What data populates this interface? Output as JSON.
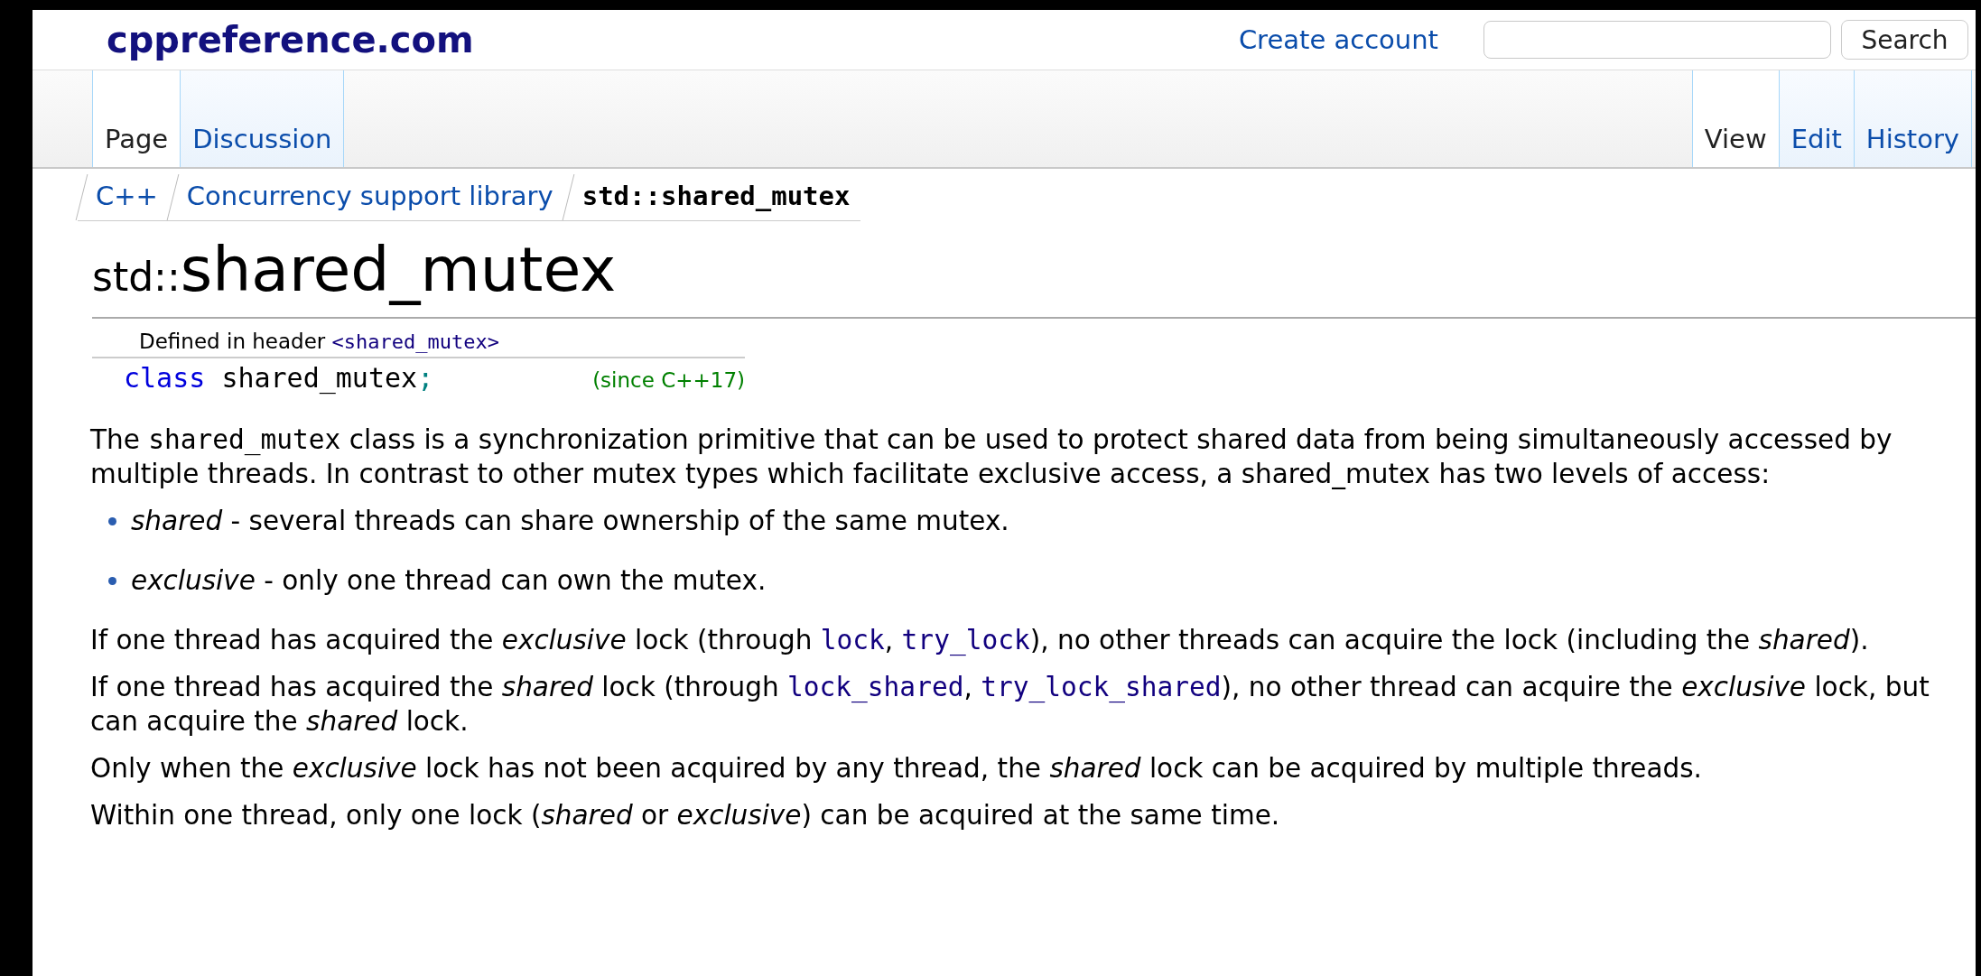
{
  "site_logo": "cppreference.com",
  "header": {
    "create_account": "Create account",
    "search_button": "Search"
  },
  "left_tabs": [
    {
      "label": "Page",
      "selected": true
    },
    {
      "label": "Discussion",
      "selected": false
    }
  ],
  "right_tabs": [
    {
      "label": "View",
      "selected": true
    },
    {
      "label": "Edit",
      "selected": false
    },
    {
      "label": "History",
      "selected": false
    }
  ],
  "breadcrumb": [
    {
      "label": "C++",
      "kind": "link"
    },
    {
      "label": "Concurrency support library",
      "kind": "link"
    },
    {
      "label": "std::shared_mutex",
      "kind": "current"
    }
  ],
  "title": {
    "namespace": "std::",
    "name": "shared_mutex"
  },
  "declaration": {
    "header_label": "Defined in header",
    "header": "<shared_mutex>",
    "keyword": "class",
    "name": "shared_mutex",
    "punct": ";",
    "since": "(since C++17)"
  },
  "content": [
    {
      "kind": "paragraph",
      "segments": [
        {
          "kind": "text",
          "text": "The "
        },
        {
          "kind": "code",
          "text": "shared_mutex"
        },
        {
          "kind": "text",
          "text": " class is a synchronization primitive that can be used to protect shared data from being simultaneously accessed by multiple threads. In contrast to other mutex types which facilitate exclusive access, a shared_mutex has two levels of access:"
        }
      ]
    },
    {
      "kind": "list",
      "items": [
        "*shared* - several threads can share ownership of the same mutex.",
        "*exclusive* - only one thread can own the mutex."
      ]
    },
    {
      "kind": "paragraph",
      "segments": [
        {
          "kind": "text",
          "text": "If one thread has acquired the *exclusive* lock (through "
        },
        {
          "kind": "link",
          "text": "lock"
        },
        {
          "kind": "text",
          "text": ", "
        },
        {
          "kind": "link",
          "text": "try_lock"
        },
        {
          "kind": "text",
          "text": "), no other threads can acquire the lock (including the *shared*)."
        }
      ]
    },
    {
      "kind": "paragraph",
      "segments": [
        {
          "kind": "text",
          "text": "If one thread has acquired the *shared* lock (through "
        },
        {
          "kind": "link",
          "text": "lock_shared"
        },
        {
          "kind": "text",
          "text": ", "
        },
        {
          "kind": "link",
          "text": "try_lock_shared"
        },
        {
          "kind": "text",
          "text": "), no other thread can acquire the *exclusive* lock, but can acquire the *shared* lock."
        }
      ]
    },
    {
      "kind": "paragraph",
      "segments": [
        {
          "kind": "text",
          "text": "Only when the *exclusive* lock has not been acquired by any thread, the *shared* lock can be acquired by multiple threads."
        }
      ]
    },
    {
      "kind": "paragraph",
      "segments": [
        {
          "kind": "text",
          "text": "Within one thread, only one lock (*shared* or *exclusive*) can be acquired at the same time."
        }
      ]
    }
  ]
}
